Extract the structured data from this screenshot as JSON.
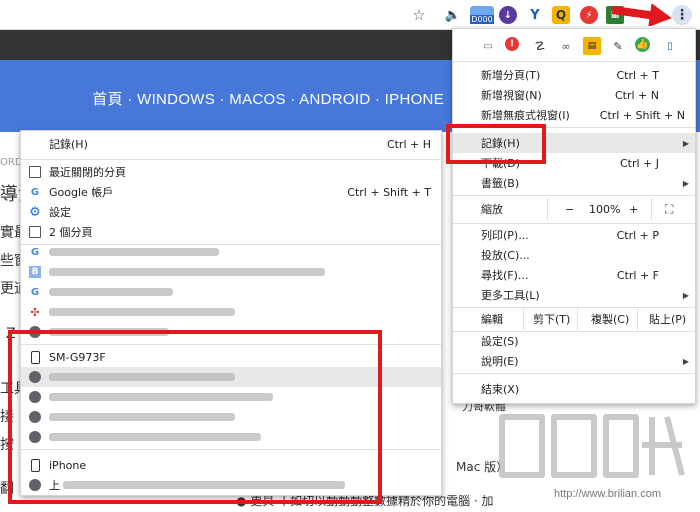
{
  "toolbar": {
    "badge_text": "D000"
  },
  "page": {
    "nav": "首頁 · WINDOWS · MACOS · ANDROID · IPHONE",
    "frag_ord": "ORD",
    "frag_1": "導法",
    "frag_2": "實最",
    "frag_3": "些窗",
    "frag_4": "更道",
    "frag_5": "Z",
    "frag_6": "工具",
    "frag_7": "接",
    "frag_8": "按",
    "frag_9": "翻",
    "frag_right_1": "力哥軟體",
    "frag_right_2": "Mac 版）",
    "frag_bottom": "● 更貝 丨如切以動動動整數據精於你的電腦 · 加"
  },
  "history_menu": {
    "header_label": "記錄(H)",
    "header_shortcut": "Ctrl + H",
    "recently_closed": "最近關閉的分頁",
    "google_account": "Google 帳戶",
    "google_account_shortcut": "Ctrl + Shift + T",
    "settings": "設定",
    "two_tabs": "2 個分頁",
    "device1_name": "SM-G973F",
    "device2_name": "iPhone",
    "device2_item_prefix": "上"
  },
  "chrome_menu": {
    "new_tab": "新增分頁(T)",
    "new_tab_sc": "Ctrl + T",
    "new_window": "新增視窗(N)",
    "new_window_sc": "Ctrl + N",
    "incognito": "新增無痕式視窗(I)",
    "incognito_sc": "Ctrl + Shift + N",
    "history": "記錄(H)",
    "downloads": "下載(D)",
    "downloads_sc": "Ctrl + J",
    "bookmarks": "書籤(B)",
    "zoom": "縮放",
    "zoom_minus": "−",
    "zoom_value": "100%",
    "zoom_plus": "+",
    "print": "列印(P)...",
    "print_sc": "Ctrl + P",
    "cast": "投放(C)...",
    "find": "尋找(F)...",
    "find_sc": "Ctrl + F",
    "more_tools": "更多工具(L)",
    "edit": "編輯",
    "cut": "剪下(T)",
    "copy": "複製(C)",
    "paste": "貼上(P)",
    "settings": "設定(S)",
    "help": "說明(E)",
    "exit": "結束(X)"
  },
  "watermark": {
    "text": "http://www.brilian.com"
  },
  "colors": {
    "annotation_red": "#e0191e",
    "page_blue": "#4778d9"
  }
}
